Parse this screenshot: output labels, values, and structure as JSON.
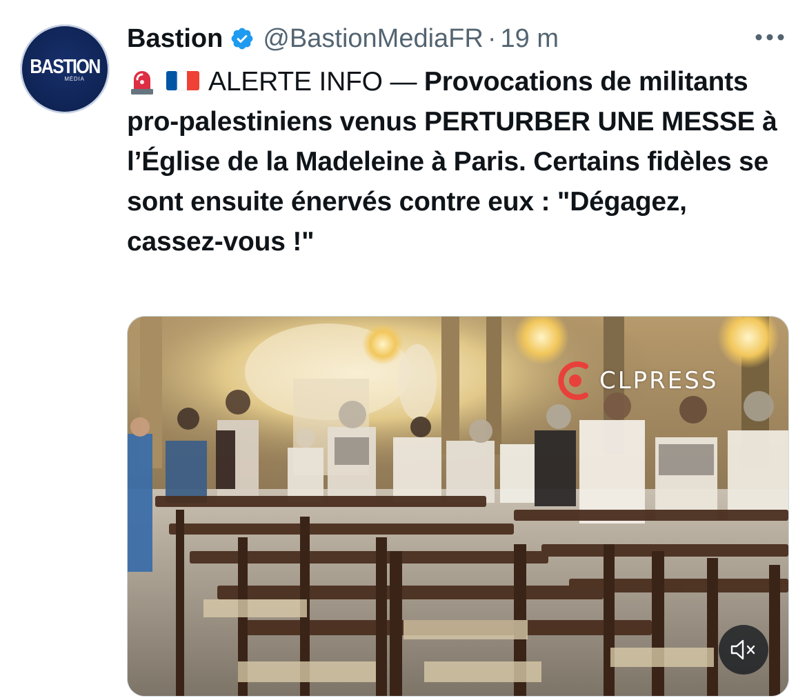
{
  "author": {
    "avatar_text": "BASTION",
    "avatar_subtext": "MÉDIA",
    "display_name": "Bastion",
    "verified": true,
    "handle": "@BastionMediaFR",
    "separator": "·",
    "timestamp": "19 m"
  },
  "tweet": {
    "emojis": [
      "rotating-light",
      "flag-france"
    ],
    "alert_prefix": "ALERTE INFO — ",
    "text": "Provocations de militants pro-palestiniens venus PERTURBER UNE MESSE à l’Église de la Madeleine à Paris. Certains fidèles se sont ensuite énervés contre eux : \"Dégagez, cassez-vous !\""
  },
  "media": {
    "type": "video",
    "watermark": "CLPRESS",
    "muted": true
  },
  "icons": {
    "more": "more-horizontal-icon",
    "verified": "verified-badge-icon",
    "mute": "volume-muted-icon"
  },
  "colors": {
    "verified_blue": "#1d9bf0",
    "secondary_text": "#536471",
    "primary_text": "#0f1419",
    "watermark_red": "#e8403a"
  }
}
